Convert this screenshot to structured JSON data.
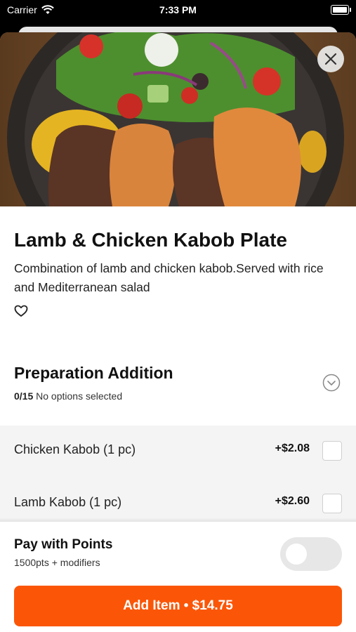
{
  "status_bar": {
    "carrier": "Carrier",
    "time": "7:33 PM",
    "icons": [
      "wifi-icon",
      "battery-icon"
    ]
  },
  "item": {
    "title": "Lamb & Chicken Kabob Plate",
    "description": "Combination of lamb and chicken kabob.Served with rice and Mediterranean salad",
    "icons": [
      "close-icon",
      "heart-icon"
    ]
  },
  "preparation": {
    "title": "Preparation Addition",
    "count": "0/15",
    "status": "No options selected",
    "icon": "chevron-down-icon",
    "options": [
      {
        "name": "Chicken Kabob (1 pc)",
        "price": "+$2.08",
        "checked": false
      },
      {
        "name": "Lamb Kabob (1 pc)",
        "price": "+$2.60",
        "checked": false
      }
    ]
  },
  "points": {
    "title": "Pay with Points",
    "subtitle": "1500pts + modifiers",
    "enabled": false
  },
  "add_button": {
    "label": "Add Item • $14.75"
  },
  "colors": {
    "accent": "#fb5607",
    "options_background": "#f4f4f4",
    "toggle_off": "#e7e7e7"
  }
}
